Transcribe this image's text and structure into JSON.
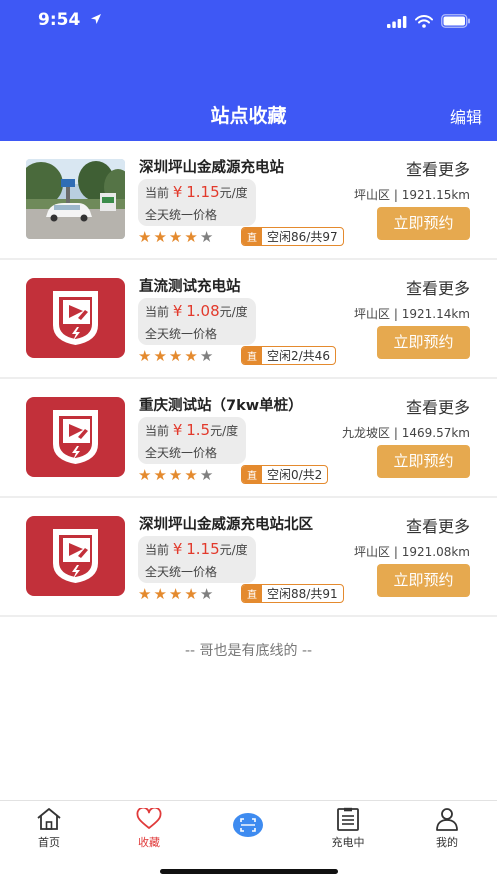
{
  "status_bar": {
    "time": "9:54"
  },
  "nav": {
    "title": "站点收藏",
    "edit": "编辑"
  },
  "stations": [
    {
      "name": "深圳坪山金威源充电站",
      "more": "查看更多",
      "price_prefix": "当前",
      "currency": "¥",
      "price": "1.15",
      "unit": "元/度",
      "price_note": "全天统一价格",
      "rating": 4,
      "rating_max": 5,
      "tag": "直",
      "availability": "空闲86/共97",
      "district": "坪山区",
      "distance": "1921.15km",
      "book": "立即预约",
      "thumb": "photo"
    },
    {
      "name": "直流测试充电站",
      "more": "查看更多",
      "price_prefix": "当前",
      "currency": "¥",
      "price": "1.08",
      "unit": "元/度",
      "price_note": "全天统一价格",
      "rating": 4,
      "rating_max": 5,
      "tag": "直",
      "availability": "空闲2/共46",
      "district": "坪山区",
      "distance": "1921.14km",
      "book": "立即预约",
      "thumb": "logo"
    },
    {
      "name": "重庆测试站（7kw单桩）",
      "more": "查看更多",
      "price_prefix": "当前",
      "currency": "¥",
      "price": "1.5",
      "unit": "元/度",
      "price_note": "全天统一价格",
      "rating": 4,
      "rating_max": 5,
      "tag": "直",
      "availability": "空闲0/共2",
      "district": "九龙坡区",
      "distance": "1469.57km",
      "book": "立即预约",
      "thumb": "logo"
    },
    {
      "name": "深圳坪山金威源充电站北区",
      "more": "查看更多",
      "price_prefix": "当前",
      "currency": "¥",
      "price": "1.15",
      "unit": "元/度",
      "price_note": "全天统一价格",
      "rating": 4,
      "rating_max": 5,
      "tag": "直",
      "availability": "空闲88/共91",
      "district": "坪山区",
      "distance": "1921.08km",
      "book": "立即预约",
      "thumb": "logo"
    }
  ],
  "footer_note": "-- 哥也是有底线的 --",
  "tabs": [
    {
      "label": "首页",
      "icon": "home-icon"
    },
    {
      "label": "收藏",
      "icon": "heart-icon",
      "active": true
    },
    {
      "label": "",
      "icon": "scan-icon"
    },
    {
      "label": "充电中",
      "icon": "clipboard-icon"
    },
    {
      "label": "我的",
      "icon": "user-icon"
    }
  ],
  "colors": {
    "header": "#3E58F5",
    "accent": "#E48A2E",
    "book_button": "#E6A94F",
    "price": "#E23A2C",
    "active_tab": "#E03A3A",
    "logo": "#C2303A"
  }
}
